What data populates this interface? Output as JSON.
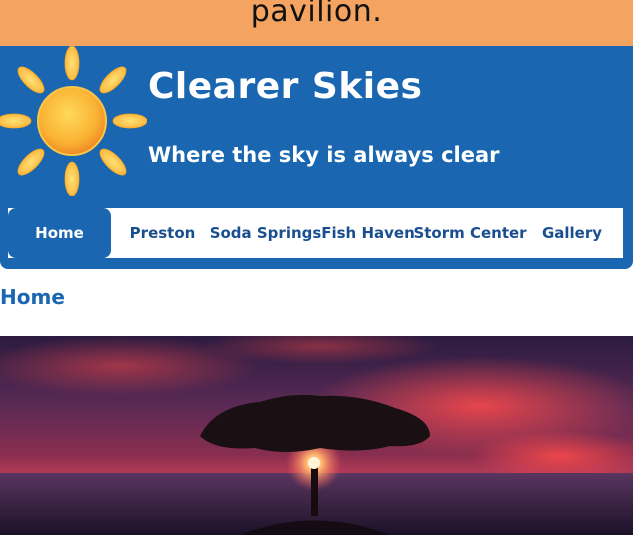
{
  "banner": {
    "text": "pavilion."
  },
  "header": {
    "title": "Clearer Skies",
    "tagline": "Where the sky is always clear"
  },
  "nav": {
    "items": [
      {
        "label": "Home",
        "active": true
      },
      {
        "label": "Preston",
        "active": false
      },
      {
        "label": "Soda Springs",
        "active": false
      },
      {
        "label": "Fish Haven",
        "active": false
      },
      {
        "label": "Storm Center",
        "active": false
      },
      {
        "label": "Gallery",
        "active": false
      }
    ]
  },
  "main": {
    "heading": "Home"
  },
  "colors": {
    "banner": "#f4a460",
    "header": "#1a66b0",
    "nav_text": "#1a4f8f",
    "sun": "#f9b233"
  },
  "icons": {
    "logo": "sun-icon",
    "hero": "sunset-tree-photo"
  }
}
